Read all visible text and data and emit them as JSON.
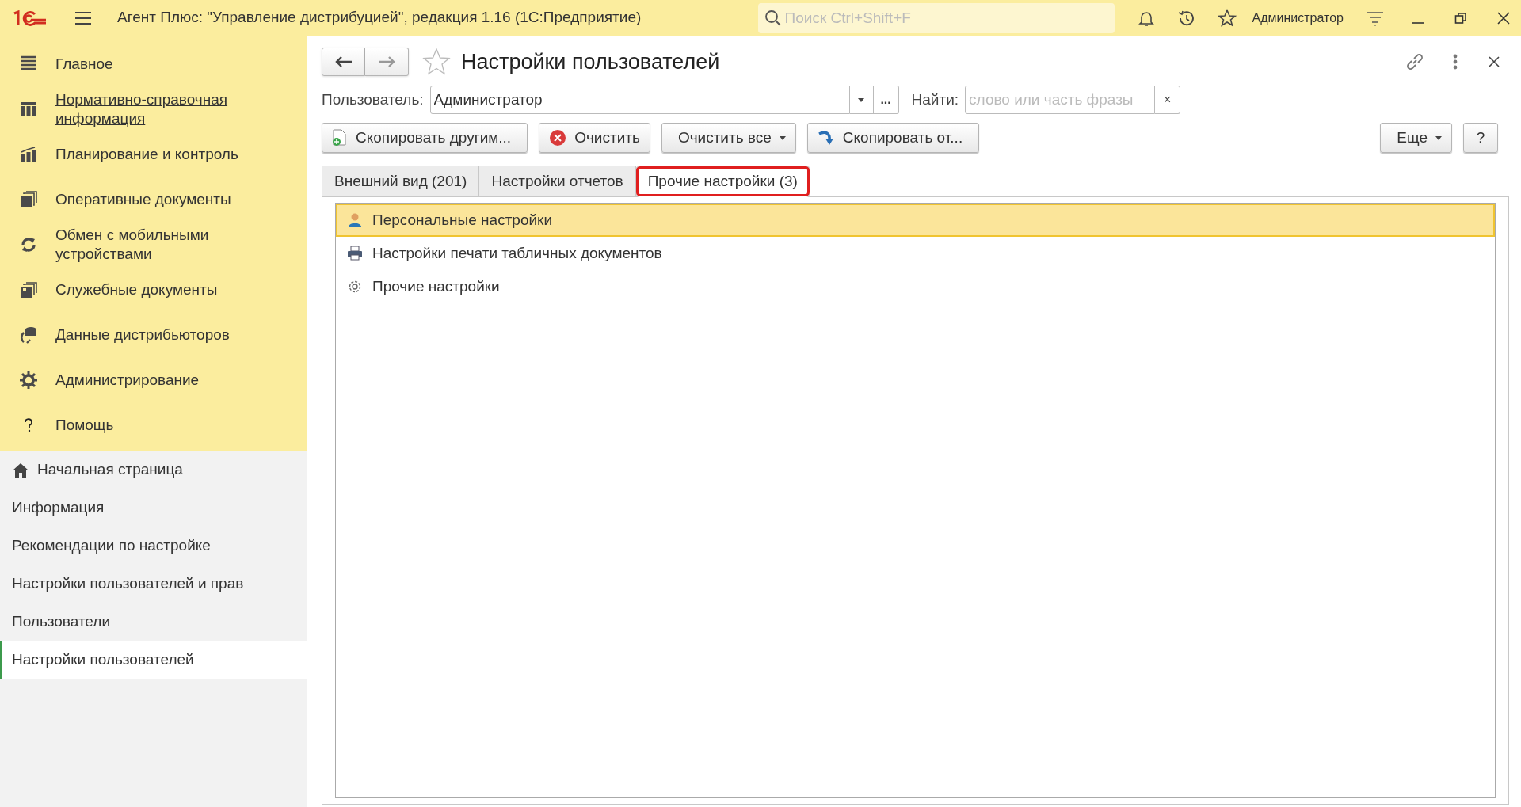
{
  "window": {
    "title": "Агент Плюс: \"Управление дистрибуцией\", редакция 1.16  (1С:Предприятие)",
    "search_placeholder": "Поиск Ctrl+Shift+F",
    "user": "Администратор"
  },
  "sections": [
    {
      "label": "Главное",
      "kind": "menu",
      "hovered": false
    },
    {
      "label": "Нормативно-справочная информация",
      "kind": "columns",
      "hovered": true
    },
    {
      "label": "Планирование и контроль",
      "kind": "chart",
      "hovered": false
    },
    {
      "label": "Оперативные документы",
      "kind": "docs",
      "hovered": false
    },
    {
      "label": "Обмен с мобильными устройствами",
      "kind": "sync",
      "hovered": false
    },
    {
      "label": "Служебные документы",
      "kind": "docs2",
      "hovered": false
    },
    {
      "label": "Данные дистрибьюторов",
      "kind": "db",
      "hovered": false
    },
    {
      "label": "Администрирование",
      "kind": "gear",
      "hovered": false
    },
    {
      "label": "Помощь",
      "kind": "help",
      "hovered": false
    }
  ],
  "open_pages": [
    {
      "label": "Начальная страница",
      "kind": "home",
      "selected": false
    },
    {
      "label": "Информация",
      "kind": "page",
      "selected": false
    },
    {
      "label": "Рекомендации по настройке",
      "kind": "page",
      "selected": false
    },
    {
      "label": "Настройки пользователей и прав",
      "kind": "page",
      "selected": false
    },
    {
      "label": "Пользователи",
      "kind": "page",
      "selected": false
    },
    {
      "label": "Настройки пользователей",
      "kind": "page",
      "selected": true
    }
  ],
  "form": {
    "title": "Настройки пользователей",
    "user_field": {
      "label": "Пользователь:",
      "value": "Администратор",
      "select_button": "..."
    },
    "find_field": {
      "label": "Найти:",
      "placeholder": "слово или часть фразы",
      "clear": "×"
    },
    "toolbar": [
      {
        "label": "Скопировать другим...",
        "kind": "copy-doc"
      },
      {
        "label": "Очистить",
        "kind": "clear"
      },
      {
        "label": "Очистить все",
        "kind": "dropdown"
      },
      {
        "label": "Скопировать от...",
        "kind": "copy-from"
      }
    ],
    "more_button": "Еще",
    "help_button": "?",
    "tabs": [
      {
        "label": "Внешний вид (201)",
        "selected": false,
        "outlined": false
      },
      {
        "label": "Настройки отчетов",
        "selected": false,
        "outlined": false
      },
      {
        "label": "Прочие настройки (3)",
        "selected": true,
        "outlined": true
      }
    ],
    "items": [
      {
        "label": "Персональные настройки",
        "kind": "person",
        "selected": true
      },
      {
        "label": "Настройки печати табличных документов",
        "kind": "printer",
        "selected": false
      },
      {
        "label": "Прочие настройки",
        "kind": "gear",
        "selected": false
      }
    ]
  }
}
